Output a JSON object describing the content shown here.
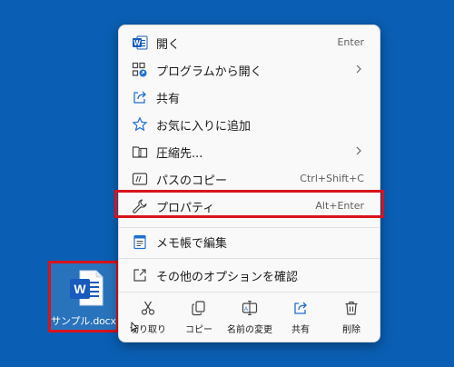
{
  "desktop": {
    "file": {
      "name": "サンプル.docx",
      "icon": "word-document-icon"
    }
  },
  "colors": {
    "desktop": "#0a5fb4",
    "highlight": "#d8131c",
    "accent": "#1f6fd1",
    "word": "#185abd"
  },
  "context_menu": {
    "items": [
      {
        "label": "開く",
        "shortcut": "Enter",
        "icon": "word-icon"
      },
      {
        "label": "プログラムから開く",
        "icon": "open-with-icon",
        "submenu": true
      },
      {
        "label": "共有",
        "icon": "share-icon"
      },
      {
        "label": "お気に入りに追加",
        "icon": "star-icon"
      },
      {
        "label": "圧縮先...",
        "icon": "zip-folder-icon",
        "submenu": true
      },
      {
        "label": "パスのコピー",
        "shortcut": "Ctrl+Shift+C",
        "icon": "copy-path-icon"
      },
      {
        "label": "プロパティ",
        "shortcut": "Alt+Enter",
        "icon": "wrench-icon",
        "highlighted": true
      },
      {
        "label": "メモ帳で編集",
        "icon": "notepad-icon"
      },
      {
        "label": "その他のオプションを確認",
        "icon": "more-options-icon"
      }
    ],
    "actions": [
      {
        "label": "切り取り",
        "icon": "scissors-icon"
      },
      {
        "label": "コピー",
        "icon": "copy-icon"
      },
      {
        "label": "名前の変更",
        "icon": "rename-icon"
      },
      {
        "label": "共有",
        "icon": "share-icon"
      },
      {
        "label": "削除",
        "icon": "trash-icon"
      }
    ]
  }
}
